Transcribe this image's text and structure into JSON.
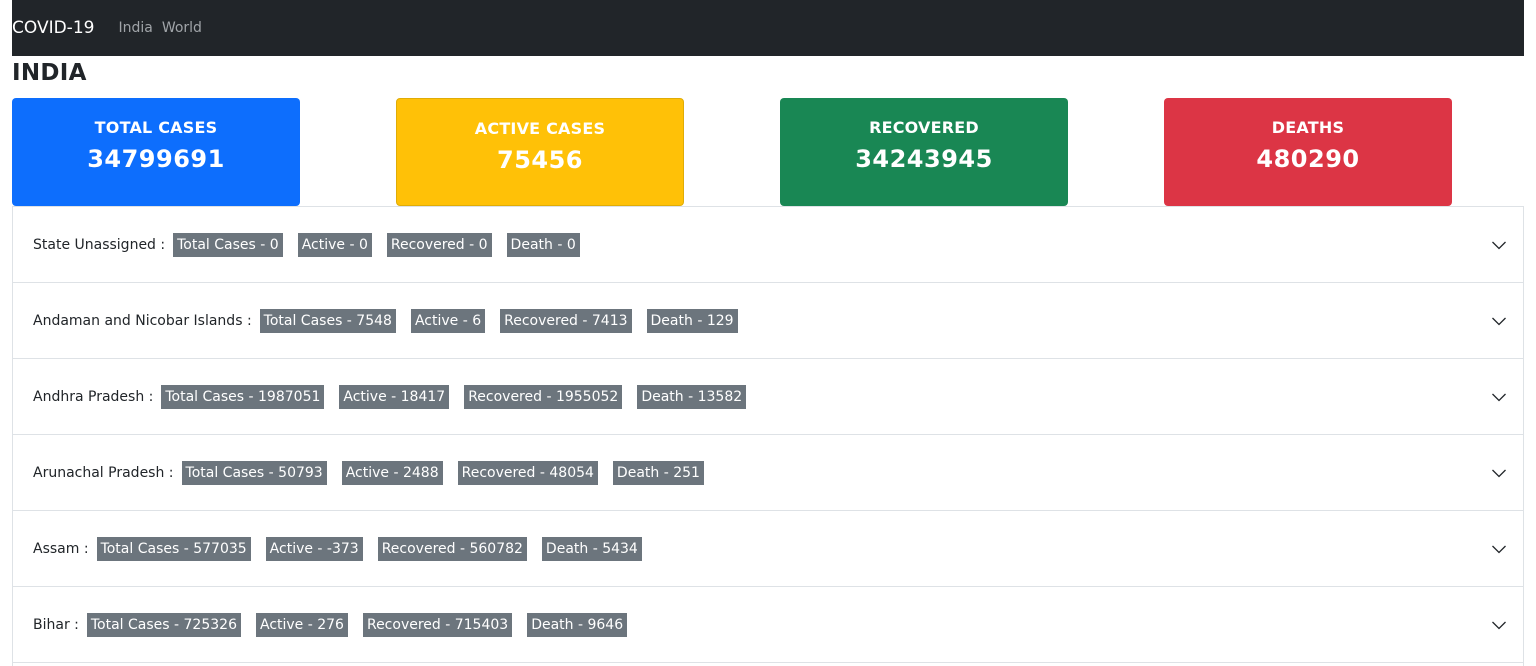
{
  "navbar": {
    "brand": "COVID-19",
    "links": [
      "India",
      "World"
    ]
  },
  "page_title": "INDIA",
  "summary": {
    "total": {
      "label": "TOTAL CASES",
      "value": "34799691",
      "color": "#0d6efd"
    },
    "active": {
      "label": "ACTIVE CASES",
      "value": "75456",
      "color": "#ffc107"
    },
    "recovered": {
      "label": "RECOVERED",
      "value": "34243945",
      "color": "#198754"
    },
    "deaths": {
      "label": "DEATHS",
      "value": "480290",
      "color": "#dc3545"
    }
  },
  "states": [
    {
      "name": "State Unassigned :",
      "total": "Total Cases - 0",
      "active": "Active - 0",
      "recovered": "Recovered - 0",
      "death": "Death - 0"
    },
    {
      "name": "Andaman and Nicobar Islands :",
      "total": "Total Cases - 7548",
      "active": "Active - 6",
      "recovered": "Recovered - 7413",
      "death": "Death - 129"
    },
    {
      "name": "Andhra Pradesh :",
      "total": "Total Cases - 1987051",
      "active": "Active - 18417",
      "recovered": "Recovered - 1955052",
      "death": "Death - 13582"
    },
    {
      "name": "Arunachal Pradesh :",
      "total": "Total Cases - 50793",
      "active": "Active - 2488",
      "recovered": "Recovered - 48054",
      "death": "Death - 251"
    },
    {
      "name": "Assam :",
      "total": "Total Cases - 577035",
      "active": "Active - -373",
      "recovered": "Recovered - 560782",
      "death": "Death - 5434"
    },
    {
      "name": "Bihar :",
      "total": "Total Cases - 725326",
      "active": "Active - 276",
      "recovered": "Recovered - 715403",
      "death": "Death - 9646"
    }
  ],
  "icons": {
    "expand": "chevron-down-icon"
  }
}
